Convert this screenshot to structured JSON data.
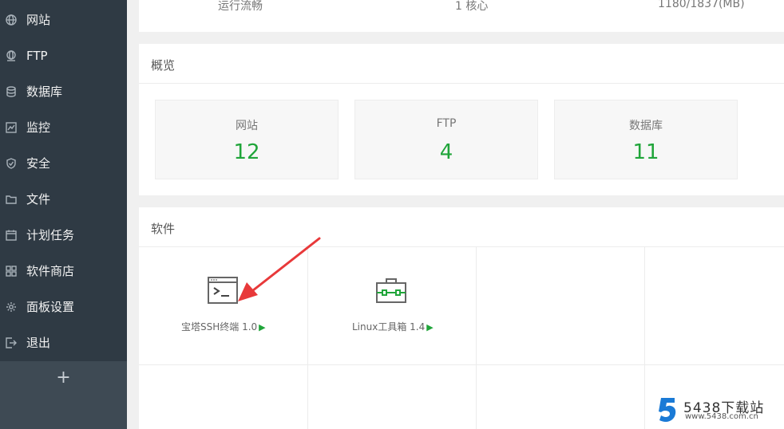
{
  "sidebar": {
    "items": [
      {
        "label": "网站",
        "icon": "globe-icon"
      },
      {
        "label": "FTP",
        "icon": "ftp-icon"
      },
      {
        "label": "数据库",
        "icon": "database-icon"
      },
      {
        "label": "监控",
        "icon": "monitor-icon"
      },
      {
        "label": "安全",
        "icon": "shield-icon"
      },
      {
        "label": "文件",
        "icon": "folder-icon"
      },
      {
        "label": "计划任务",
        "icon": "calendar-icon"
      },
      {
        "label": "软件商店",
        "icon": "grid-icon"
      },
      {
        "label": "面板设置",
        "icon": "gear-icon"
      },
      {
        "label": "退出",
        "icon": "logout-icon"
      }
    ],
    "add_label": "+"
  },
  "top_status": {
    "load": "运行流畅",
    "cpu": "1 核心",
    "memory": "1180/1837(MB)"
  },
  "overview": {
    "title": "概览",
    "stats": [
      {
        "label": "网站",
        "value": "12"
      },
      {
        "label": "FTP",
        "value": "4"
      },
      {
        "label": "数据库",
        "value": "11"
      }
    ]
  },
  "software": {
    "title": "软件",
    "apps": [
      {
        "name": "宝塔SSH终端 1.0",
        "play": "▶",
        "icon": "terminal-icon"
      },
      {
        "name": "Linux工具箱 1.4",
        "play": "▶",
        "icon": "toolbox-icon"
      }
    ]
  },
  "watermark": {
    "logo": "5",
    "title": "5438下载站",
    "url": "www.5438.com.cn"
  },
  "colors": {
    "sidebar_bg": "#2f3a44",
    "accent_green": "#20a53a",
    "arrow_red": "#e8393a"
  }
}
